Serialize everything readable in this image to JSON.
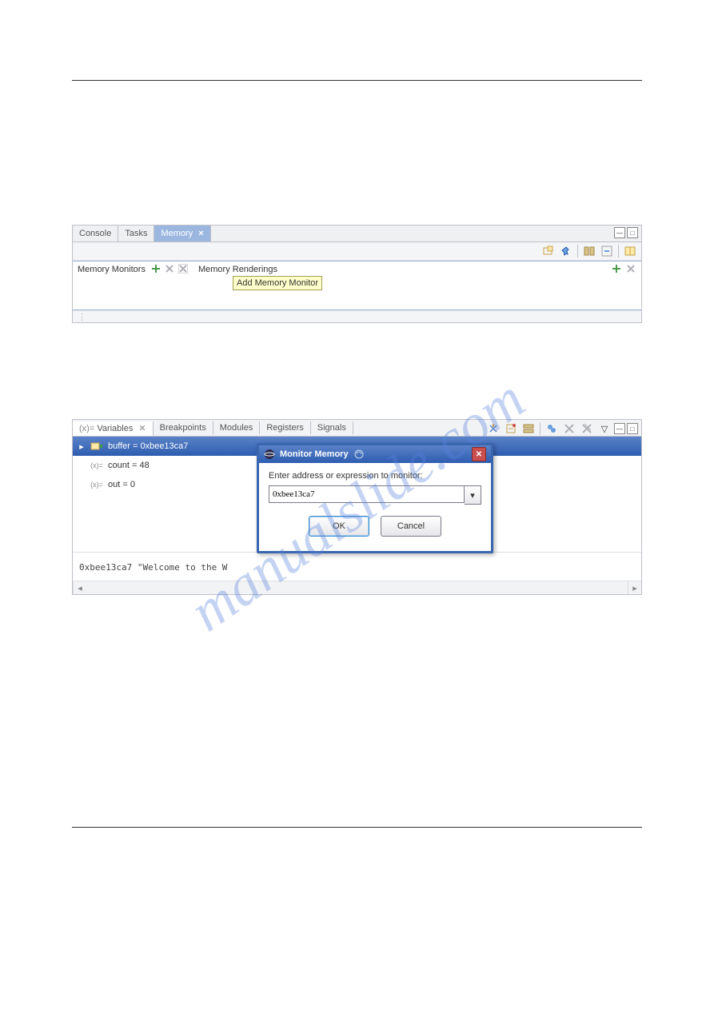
{
  "watermark": "manualslide.com",
  "memory_view": {
    "tabs": [
      {
        "label": "Console",
        "active": false
      },
      {
        "label": "Tasks",
        "active": false
      },
      {
        "label": "Memory",
        "active": true,
        "closable": true
      }
    ],
    "monitors_label": "Memory Monitors",
    "renderings_label": "Memory Renderings",
    "tooltip": "Add Memory Monitor"
  },
  "variables_view": {
    "tabs": [
      "Variables",
      "Breakpoints",
      "Modules",
      "Registers",
      "Signals"
    ],
    "active_tab": 0,
    "rows": [
      {
        "icon": "ptr",
        "text": "buffer = 0xbee13ca7",
        "selected": true,
        "expandable": true
      },
      {
        "icon": "var",
        "text": "count = 48",
        "selected": false,
        "expandable": false
      },
      {
        "icon": "var",
        "text": "out = 0",
        "selected": false,
        "expandable": false
      }
    ],
    "detail": "0xbee13ca7 \"Welcome to the W"
  },
  "dialog": {
    "title": "Monitor Memory",
    "prompt": "Enter address or expression to monitor:",
    "value": "0xbee13ca7",
    "ok": "OK",
    "cancel": "Cancel"
  }
}
